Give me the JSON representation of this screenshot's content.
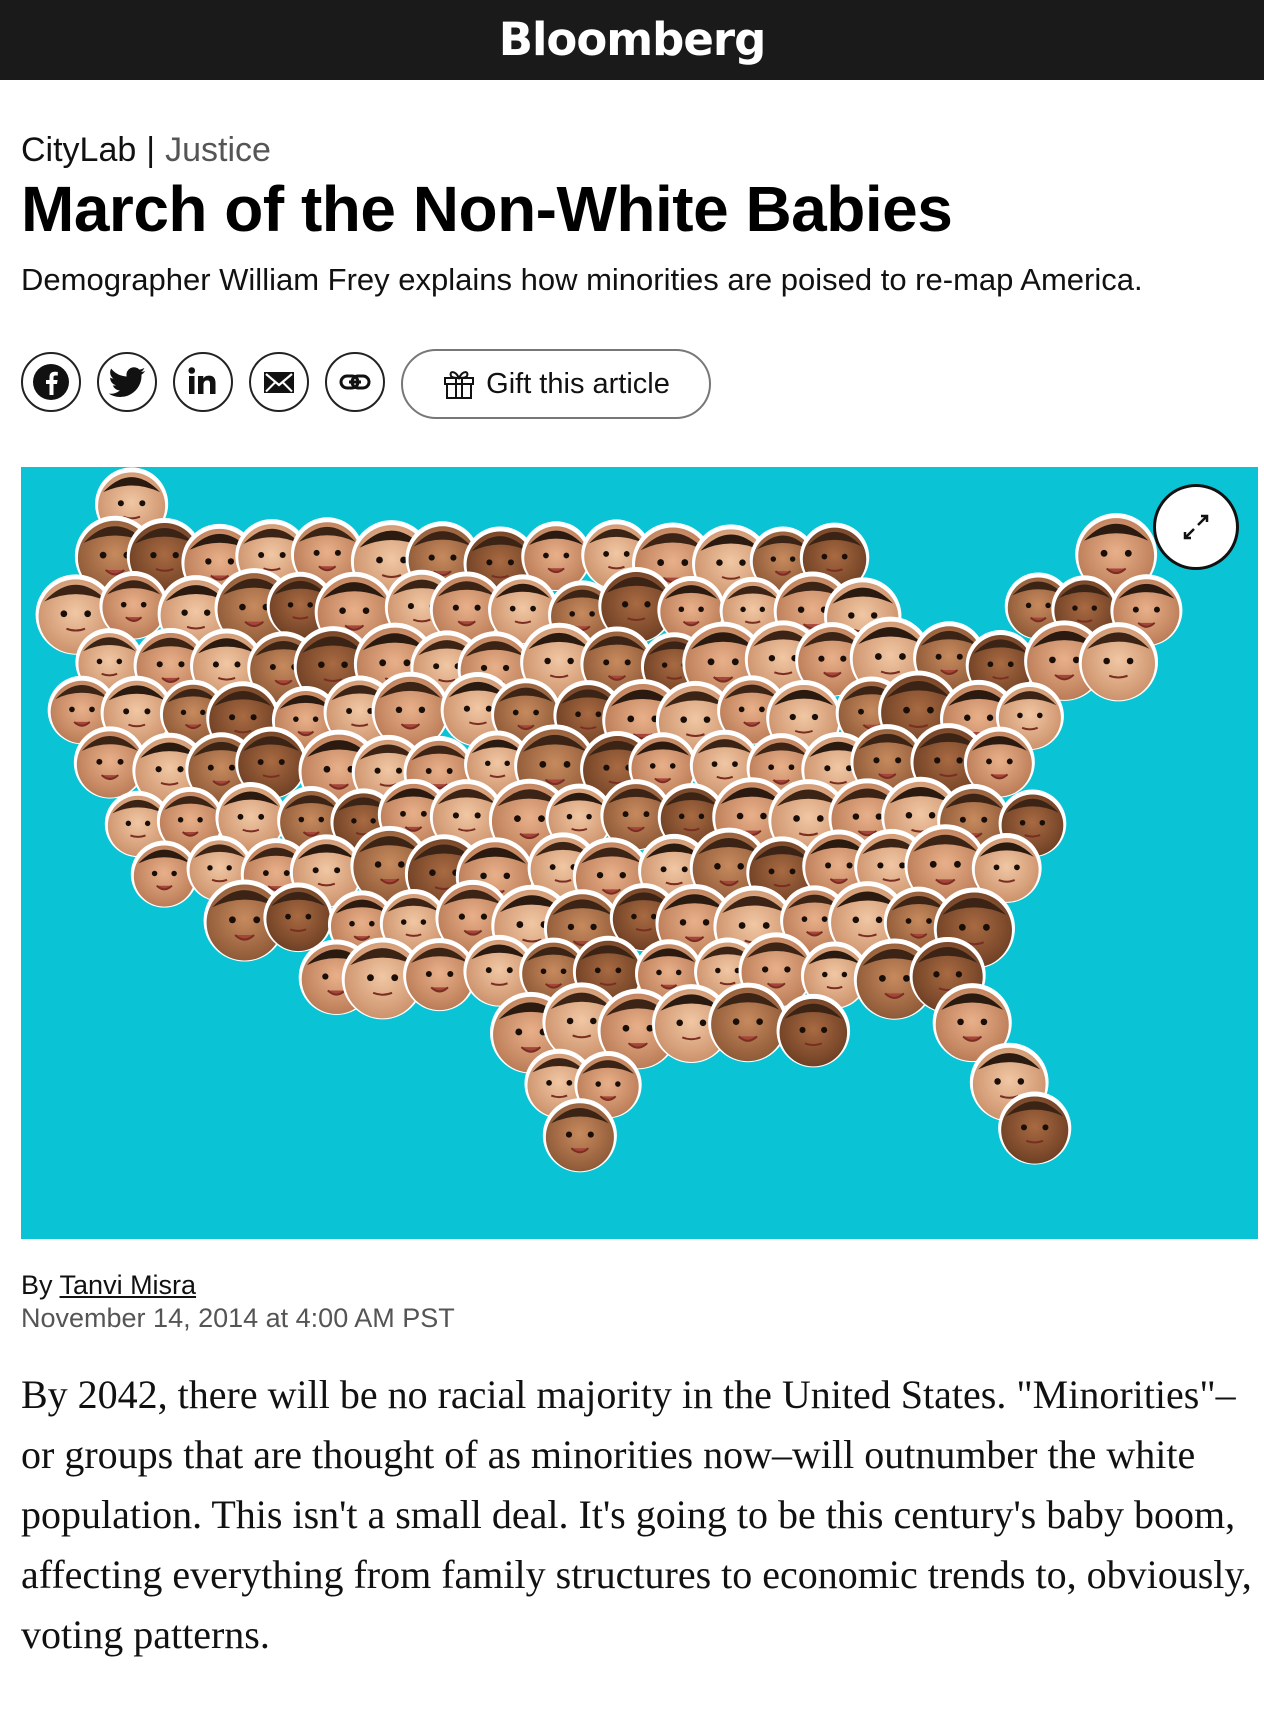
{
  "header": {
    "brand": "Bloomberg"
  },
  "article": {
    "section": "CityLab",
    "separator": "|",
    "subsection": "Justice",
    "headline": "March of the Non-White Babies",
    "dek": "Demographer William Frey explains how minorities are poised to re-map America.",
    "share_icons": [
      "facebook-icon",
      "twitter-icon",
      "linkedin-icon",
      "email-icon",
      "link-icon"
    ],
    "gift_label": "Gift this article",
    "hero_image": {
      "background_color": "#0ac4d6",
      "expand_icon": "expand-arrows-icon"
    },
    "byline_prefix": "By",
    "author": "Tanvi Misra",
    "date": "November 14, 2014 at 4:00 AM PST",
    "body": "By 2042, there will be no racial majority in the United States. \"Minorities\"–or groups that are thought of as minorities now–will outnumber the white population. This isn't a small deal. It's going to be this century's baby boom, affecting everything from family structures to economic trends to, obviously, voting patterns."
  }
}
